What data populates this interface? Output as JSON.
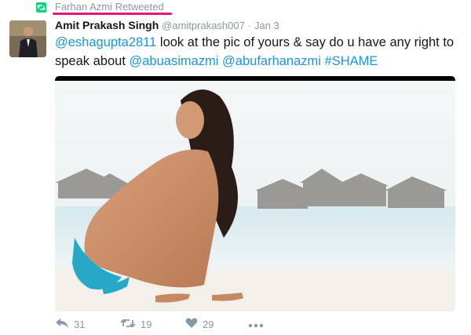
{
  "retweet_banner": {
    "text": "Farhan Azmi Retweeted"
  },
  "tweet": {
    "author": {
      "name": "Amit Prakash Singh",
      "handle": "@amitprakash007"
    },
    "separator": "·",
    "time": "Jan 3",
    "text": {
      "mention1": "@eshagupta2811",
      "body1": " look at the pic of yours & say do u have any right to speak  about ",
      "mention2": "@abuasimazmi",
      "space": " ",
      "mention3": "@abufarhanazmi",
      "hashtag": "#SHAME"
    }
  },
  "actions": {
    "reply_count": "31",
    "retweet_count": "19",
    "like_count": "29"
  },
  "colors": {
    "link": "#1b95e0",
    "retweet_green": "#19cf86",
    "highlight_underline": "#e0187c",
    "meta_gray": "#8899a6"
  }
}
